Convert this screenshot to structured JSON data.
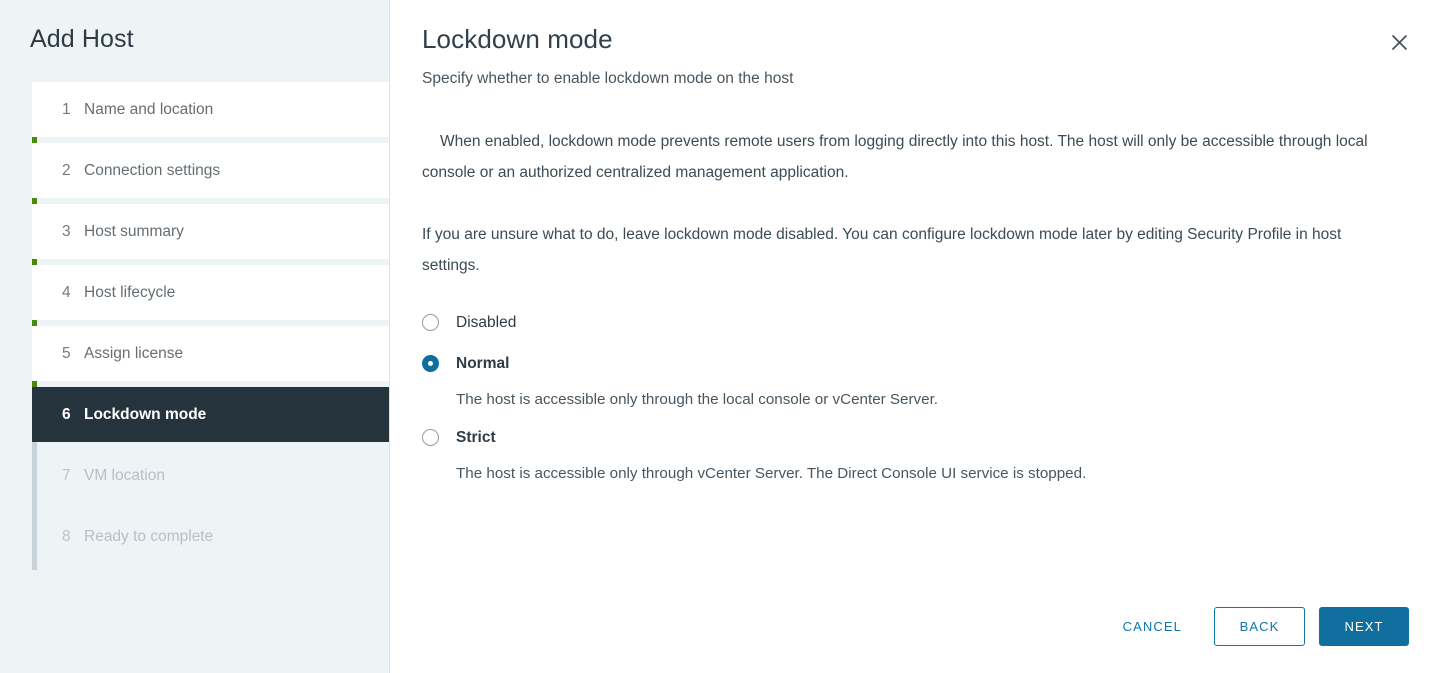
{
  "wizard": {
    "title": "Add Host",
    "steps": [
      {
        "num": "1",
        "label": "Name and location",
        "state": "done"
      },
      {
        "num": "2",
        "label": "Connection settings",
        "state": "done"
      },
      {
        "num": "3",
        "label": "Host summary",
        "state": "done"
      },
      {
        "num": "4",
        "label": "Host lifecycle",
        "state": "done"
      },
      {
        "num": "5",
        "label": "Assign license",
        "state": "done"
      },
      {
        "num": "6",
        "label": "Lockdown mode",
        "state": "active"
      },
      {
        "num": "7",
        "label": "VM location",
        "state": "pending"
      },
      {
        "num": "8",
        "label": "Ready to complete",
        "state": "pending"
      }
    ]
  },
  "content": {
    "title": "Lockdown mode",
    "subtitle": "Specify whether to enable lockdown mode on the host",
    "paragraph_1": "When enabled, lockdown mode prevents remote users from logging directly into this host. The host will only be accessible through local console or an authorized centralized management application.",
    "paragraph_2": "If you are unsure what to do, leave lockdown mode disabled. You can configure lockdown mode later by editing Security Profile in host settings.",
    "close_icon": "close-icon"
  },
  "lockdown_options": [
    {
      "label": "Disabled",
      "selected": false,
      "bold": false,
      "description": ""
    },
    {
      "label": "Normal",
      "selected": true,
      "bold": true,
      "description": "The host is accessible only through the local console or vCenter Server."
    },
    {
      "label": "Strict",
      "selected": false,
      "bold": true,
      "description": "The host is accessible only through vCenter Server. The Direct Console UI service is stopped."
    }
  ],
  "footer": {
    "cancel_label": "CANCEL",
    "back_label": "BACK",
    "next_label": "NEXT"
  },
  "colors": {
    "accent_blue": "#0f6e9d",
    "link_blue": "#1176a8",
    "progress_green": "#48890f",
    "active_step_bg": "#25333d",
    "sidebar_bg": "#eef3f6"
  }
}
